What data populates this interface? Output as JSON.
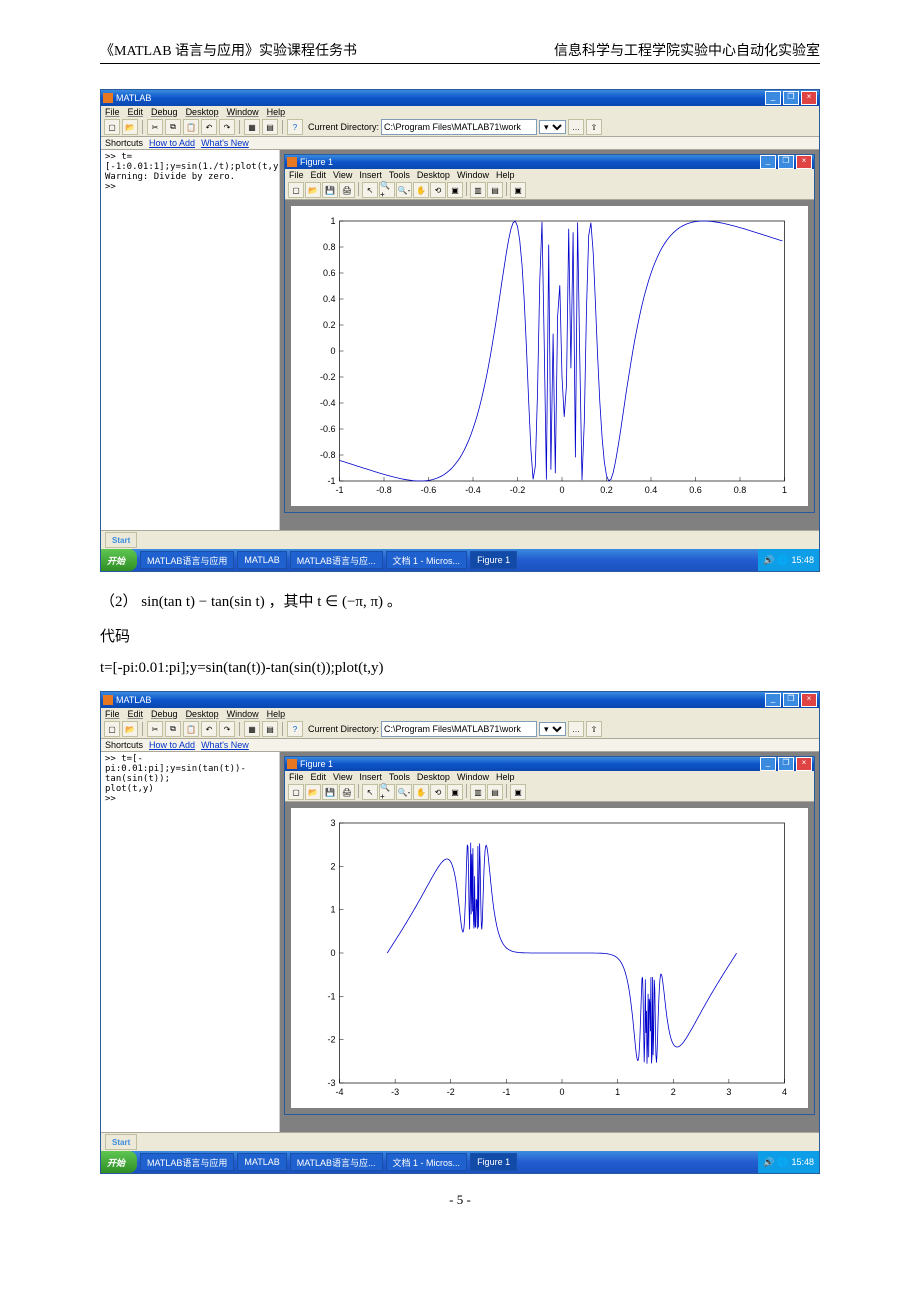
{
  "doc": {
    "header_left": "《MATLAB 语言与应用》实验课程任务书",
    "header_right": "信息科学与工程学院实验中心自动化实验室",
    "line2_prefix": "（2） ",
    "line2_math": "sin(tan t) − tan(sin t) ",
    "line2_mid": "，其中 ",
    "line2_math2": "t ∈ (−π, π)",
    "line2_end": " 。",
    "code_label": "代码",
    "code_line": "t=[-pi:0.01:pi];y=sin(tan(t))-tan(sin(t));plot(t,y)",
    "page_num": "- 5 -"
  },
  "matlab": {
    "title": "MATLAB",
    "menu": [
      "File",
      "Edit",
      "Debug",
      "Desktop",
      "Window",
      "Help"
    ],
    "cd_label": "Current Directory:",
    "cd_value": "C:\\Program Files\\MATLAB71\\work",
    "shortcuts_label": "Shortcuts",
    "shortcuts": [
      "How to Add",
      "What's New"
    ],
    "cmd1": ">> t=[-1:0.01:1];y=sin(1./t);plot(t,y)\nWarning: Divide by zero.\n>>",
    "cmd2": ">> t=[-pi:0.01:pi];y=sin(tan(t))-tan(sin(t));\nplot(t,y)\n>>",
    "status_start": "Start",
    "taskbar": {
      "start": "开始",
      "items": [
        "MATLAB语言与应用",
        "MATLAB",
        "MATLAB语言与应...",
        "文档 1 - Micros...",
        "Figure 1"
      ],
      "time": "15:48"
    }
  },
  "figure": {
    "title": "Figure 1",
    "menu": [
      "File",
      "Edit",
      "View",
      "Insert",
      "Tools",
      "Desktop",
      "Window",
      "Help"
    ]
  },
  "chart_data": [
    {
      "type": "line",
      "title": "",
      "xlabel": "",
      "ylabel": "",
      "x_ticks": [
        -1,
        -0.8,
        -0.6,
        -0.4,
        -0.2,
        0,
        0.2,
        0.4,
        0.6,
        0.8,
        1
      ],
      "y_ticks": [
        -1,
        -0.8,
        -0.6,
        -0.4,
        -0.2,
        0,
        0.2,
        0.4,
        0.6,
        0.8,
        1
      ],
      "xlim": [
        -1,
        1
      ],
      "ylim": [
        -1,
        1
      ],
      "description": "y = sin(1/t), t in [-1,1]; rapid oscillation near t=0",
      "series": [
        {
          "name": "sin(1/t)",
          "x_range": [
            -1,
            1
          ],
          "step": 0.01,
          "formula": "sin(1/t)"
        }
      ]
    },
    {
      "type": "line",
      "title": "",
      "xlabel": "",
      "ylabel": "",
      "x_ticks": [
        -4,
        -3,
        -2,
        -1,
        0,
        1,
        2,
        3,
        4
      ],
      "y_ticks": [
        -3,
        -2,
        -1,
        0,
        1,
        2,
        3
      ],
      "xlim": [
        -4,
        4
      ],
      "ylim": [
        -3,
        3
      ],
      "description": "y = sin(tan t) - tan(sin t), t in [-pi,pi]; oscillation near ±pi/2",
      "series": [
        {
          "name": "sin(tan t)-tan(sin t)",
          "x_range": [
            -3.1416,
            3.1416
          ],
          "step": 0.01,
          "formula": "sin(tan(t))-tan(sin(t))"
        }
      ]
    }
  ]
}
